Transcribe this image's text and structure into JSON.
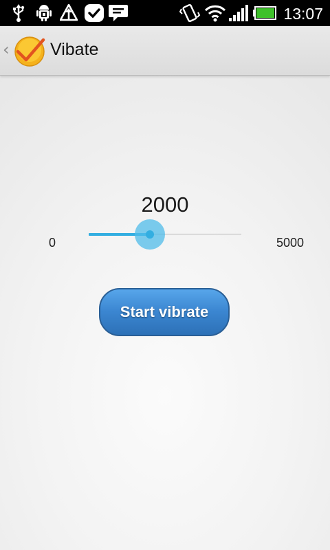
{
  "status_bar": {
    "time": "13:07",
    "icons": [
      "usb-icon",
      "android-debug-icon",
      "upload-icon",
      "task-check-icon",
      "message-icon",
      "vibrate-mode-icon",
      "wifi-icon",
      "signal-icon",
      "battery-icon"
    ]
  },
  "action_bar": {
    "title": "Vibate",
    "up_icon": "back-caret-icon",
    "app_icon": "checkmark-app-icon"
  },
  "slider": {
    "value_label": "2000",
    "min_label": "0",
    "max_label": "5000",
    "value": 2000,
    "min": 0,
    "max": 5000
  },
  "button": {
    "label": "Start vibrate"
  },
  "colors": {
    "accent": "#33aee1",
    "button": "#3b86d1"
  }
}
